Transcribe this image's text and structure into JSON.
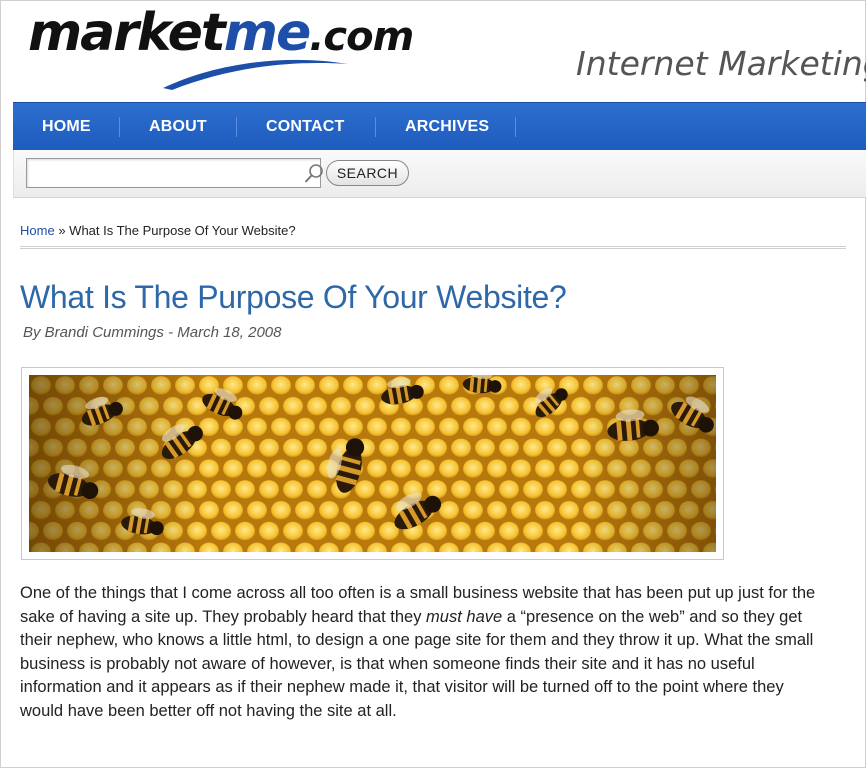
{
  "header": {
    "logo": {
      "part1": "market",
      "part2": "me",
      "part3": ".com"
    },
    "tagline": "Internet Marketing f"
  },
  "nav": {
    "items": [
      {
        "label": "HOME"
      },
      {
        "label": "ABOUT"
      },
      {
        "label": "CONTACT"
      },
      {
        "label": "ARCHIVES"
      }
    ]
  },
  "search": {
    "input_value": "",
    "placeholder": "",
    "button_label": "SEARCH",
    "icon": "magnifier-icon"
  },
  "breadcrumb": {
    "home": "Home",
    "separator": "»",
    "current": "What Is The Purpose Of Your Website?"
  },
  "post": {
    "title": "What Is The Purpose Of Your Website?",
    "byline_prefix": "By Brandi Cummings",
    "byline_sep": "-",
    "date": "March 18, 2008",
    "image_subject": "honeybees-on-honeycomb",
    "body": {
      "p1_a": "One of the things that I come across all too often is a small business website that has been put up just for the sake of having a site up.  They probably heard that they ",
      "p1_em": "must have",
      "p1_b": " a “presence on the web” and so they get their nephew, who knows a little html, to design a one page site for them and they throw it up.  What the small business is probably not aware of however, is that when someone finds their site and it has no useful information and it appears as if their nephew made it, that visitor will be turned off to the point where they would have been better off not having the site at all."
    }
  },
  "colors": {
    "nav_blue": "#1e5bbd",
    "title_blue": "#2e68a8",
    "link_blue": "#1d4fa8"
  }
}
